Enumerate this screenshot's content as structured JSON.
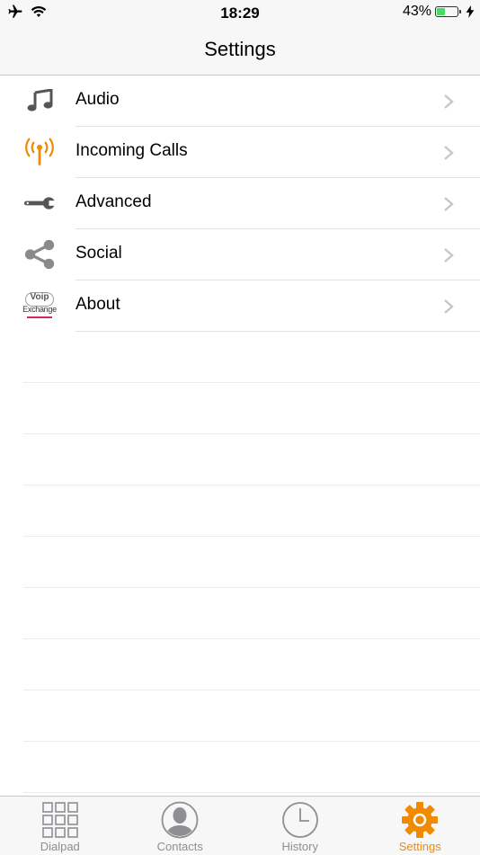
{
  "status_bar": {
    "time": "18:29",
    "battery_percent_label": "43%",
    "battery_level": 0.43,
    "icons": [
      "airplane-icon",
      "wifi-icon",
      "charging-bolt-icon"
    ]
  },
  "nav": {
    "title": "Settings"
  },
  "settings_items": [
    {
      "label": "Audio",
      "icon": "music-note-icon"
    },
    {
      "label": "Incoming Calls",
      "icon": "broadcast-antenna-icon"
    },
    {
      "label": "Advanced",
      "icon": "wrench-icon"
    },
    {
      "label": "Social",
      "icon": "share-icon"
    },
    {
      "label": "About",
      "icon": "voip-exchange-logo-icon"
    }
  ],
  "about_logo": {
    "line1": "Voip",
    "line2": "Exchange"
  },
  "tabs": [
    {
      "label": "Dialpad",
      "icon": "dialpad-grid-icon",
      "active": false
    },
    {
      "label": "Contacts",
      "icon": "contact-person-icon",
      "active": false
    },
    {
      "label": "History",
      "icon": "clock-icon",
      "active": false
    },
    {
      "label": "Settings",
      "icon": "gear-icon",
      "active": true
    }
  ],
  "colors": {
    "accent": "#f08a00",
    "inactive_tab": "#8e8e93",
    "battery_fill": "#4cd964",
    "bar_background": "#f7f7f7"
  }
}
